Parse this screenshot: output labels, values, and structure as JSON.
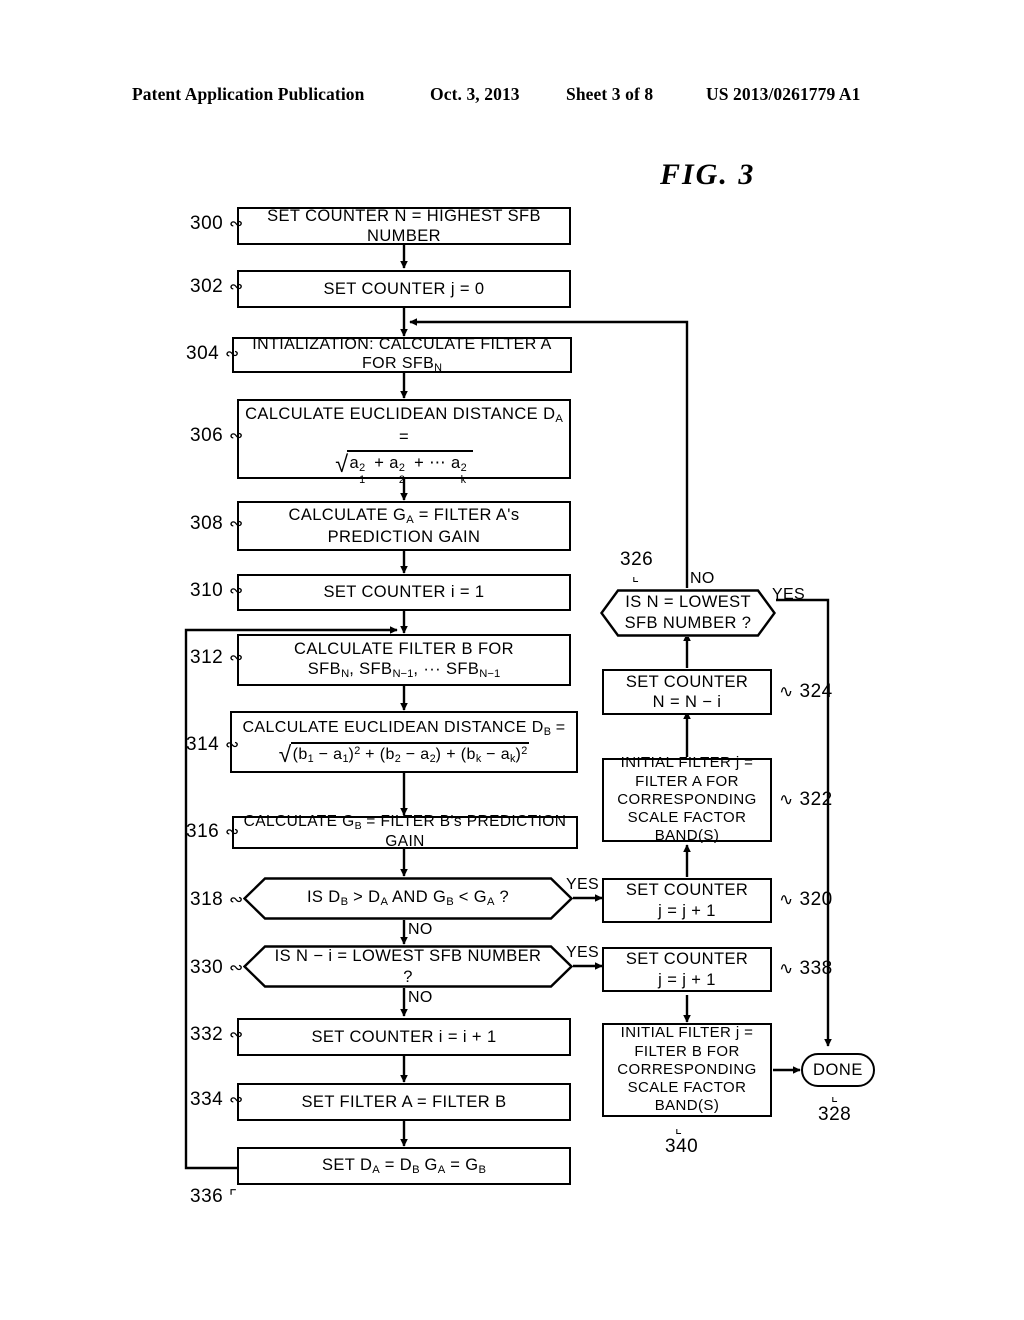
{
  "header": {
    "publication": "Patent Application Publication",
    "date": "Oct. 3, 2013",
    "sheet": "Sheet 3 of 8",
    "document_number": "US 2013/0261779 A1"
  },
  "figure": {
    "title": "FIG.  3"
  },
  "nodes": {
    "n300": {
      "ref": "300",
      "text": "SET COUNTER N  =  HIGHEST SFB NUMBER"
    },
    "n302": {
      "ref": "302",
      "text": "SET COUNTER j  =  0"
    },
    "n304": {
      "ref": "304",
      "text": "INTIALIZATION: CALCULATE FILTER A FOR SFB",
      "subscript": "N"
    },
    "n306": {
      "ref": "306",
      "line1": "CALCULATE EUCLIDEAN DISTANCE D",
      "line1_sub": "A",
      "line1_tail": " =",
      "formula": "sqrt( a_1^2 + a_2^2 + ... a_k^2 )"
    },
    "n308": {
      "ref": "308",
      "line1": "CALCULATE G",
      "line1_sub": "A",
      "line1_tail": " = FILTER A's",
      "line2": "PREDICTION GAIN"
    },
    "n310": {
      "ref": "310",
      "text": "SET COUNTER i  =  1"
    },
    "n312": {
      "ref": "312",
      "line1": "CALCULATE FILTER B FOR",
      "line2_parts": [
        "SFB",
        "N",
        ", SFB",
        "N−1",
        ", ··· SFB",
        "N−1"
      ]
    },
    "n314": {
      "ref": "314",
      "line1": "CALCULATE EUCLIDEAN DISTANCE D",
      "line1_sub": "B",
      "line1_tail": " =",
      "formula": "sqrt( (b_1 - a_1)^2 + (b_2 - a_2) + (b_k - a_k)^2 )"
    },
    "n316": {
      "ref": "316",
      "line1": "CALCULATE G",
      "line1_sub": "B",
      "line1_tail": " = FILTER B's PREDICTION GAIN"
    },
    "n318": {
      "ref": "318",
      "text_parts": [
        "IS D",
        "B",
        " > D",
        "A",
        " AND G",
        "B",
        " < G",
        "A",
        " ?"
      ],
      "yes_label": "YES",
      "no_label": "NO"
    },
    "n330": {
      "ref": "330",
      "text": "IS N − i  =  LOWEST SFB NUMBER ?",
      "yes_label": "YES",
      "no_label": "NO"
    },
    "n332": {
      "ref": "332",
      "text": "SET COUNTER i  =  i + 1"
    },
    "n334": {
      "ref": "334",
      "text": "SET FILTER A  =  FILTER B"
    },
    "n336": {
      "ref": "336",
      "text_parts": [
        "SET D",
        "A",
        "  =  D",
        "B",
        "      G",
        "A",
        "  =  G",
        "B"
      ]
    },
    "n326": {
      "ref": "326",
      "line1": "IS N  =  LOWEST",
      "line2": "SFB NUMBER ?",
      "yes_label": "YES",
      "no_label": "NO"
    },
    "n324": {
      "ref": "324",
      "line1": "SET COUNTER",
      "line2": "N  =  N − i"
    },
    "n322": {
      "ref": "322",
      "line1": "INITIAL FILTER j  =",
      "line2": "FILTER A FOR",
      "line3": "CORRESPONDING",
      "line4": "SCALE FACTOR BAND(S)"
    },
    "n320": {
      "ref": "320",
      "line1": "SET COUNTER",
      "line2": "j  =  j + 1"
    },
    "n338": {
      "ref": "338",
      "line1": "SET COUNTER",
      "line2": "j  =  j + 1"
    },
    "n340": {
      "ref": "340",
      "line1": "INITIAL FILTER j  =",
      "line2": "FILTER B FOR",
      "line3": "CORRESPONDING",
      "line4": "SCALE FACTOR BAND(S)"
    },
    "n328": {
      "ref": "328",
      "text": "DONE"
    }
  },
  "colors": {
    "ink": "#000000",
    "paper": "#ffffff"
  }
}
